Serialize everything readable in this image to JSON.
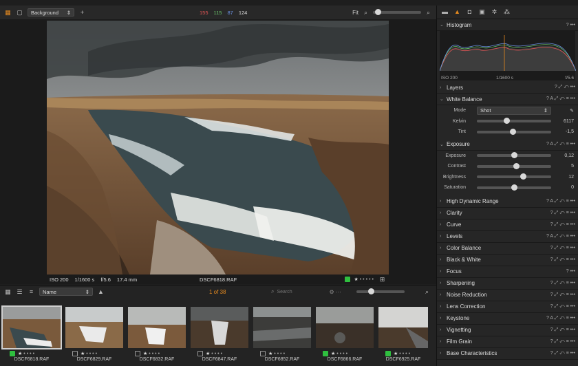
{
  "toolbar": {
    "workspace": "Background",
    "rgb": [
      "155",
      "115",
      "87",
      "124"
    ],
    "fit": "Fit"
  },
  "viewer": {
    "iso": "ISO 200",
    "shutter": "1/1600 s",
    "aperture": "f/5.6",
    "focal": "17.4 mm",
    "filename": "DSCF6818.RAF"
  },
  "browser": {
    "sort": "Name",
    "count": "1 of 38",
    "search_placeholder": "Search",
    "thumbs": [
      {
        "name": "DSCF6818.RAF",
        "tag": "green",
        "selected": true
      },
      {
        "name": "DSCF6829.RAF",
        "tag": "empty",
        "selected": false
      },
      {
        "name": "DSCF6832.RAF",
        "tag": "empty",
        "selected": false
      },
      {
        "name": "DSCF6847.RAF",
        "tag": "empty",
        "selected": false
      },
      {
        "name": "DSCF6852.RAF",
        "tag": "empty",
        "selected": false
      },
      {
        "name": "DSCF6866.RAF",
        "tag": "green",
        "selected": false
      },
      {
        "name": "DSCF6925.RAF",
        "tag": "green",
        "selected": false
      }
    ]
  },
  "panel": {
    "histogram": {
      "title": "Histogram",
      "iso": "ISO 200",
      "shutter": "1/1600 s",
      "aperture": "f/5.6"
    },
    "layers": "Layers",
    "white_balance": {
      "title": "White Balance",
      "mode_label": "Mode",
      "mode_value": "Shot",
      "kelvin_label": "Kelvin",
      "kelvin_value": "6117",
      "tint_label": "Tint",
      "tint_value": "-1,5"
    },
    "exposure": {
      "title": "Exposure",
      "rows": [
        {
          "label": "Exposure",
          "value": "0,12",
          "level": 0.5
        },
        {
          "label": "Contrast",
          "value": "5",
          "level": 0.53
        },
        {
          "label": "Brightness",
          "value": "12",
          "level": 0.62
        },
        {
          "label": "Saturation",
          "value": "0",
          "level": 0.5
        }
      ]
    },
    "sections": [
      "High Dynamic Range",
      "Clarity",
      "Curve",
      "Levels",
      "Color Balance",
      "Black & White",
      "Focus",
      "Sharpening",
      "Noise Reduction",
      "Lens Correction",
      "Keystone",
      "Vignetting",
      "Film Grain",
      "Base Characteristics"
    ]
  },
  "colors": {
    "accent": "#e58a1f",
    "tag_green": "#2fbf3f"
  }
}
